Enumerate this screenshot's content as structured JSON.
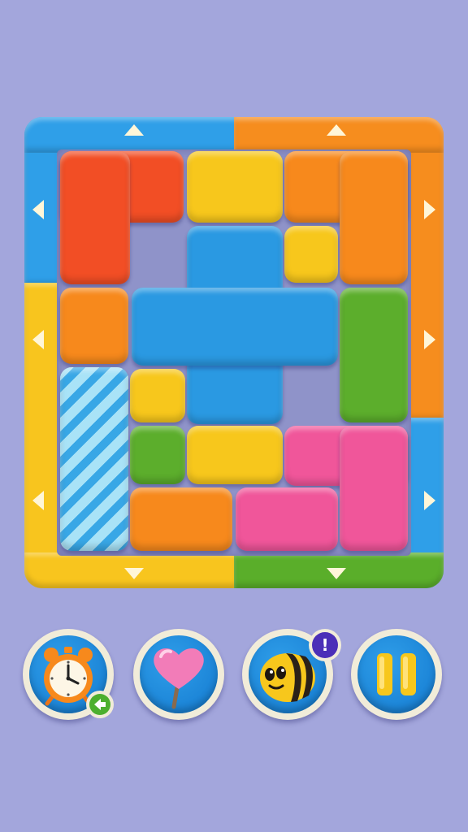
{
  "game": {
    "board": {
      "columns": 5,
      "rows": 6,
      "exit_arrows": [
        "up",
        "up",
        "left",
        "right",
        "left",
        "right",
        "left",
        "right",
        "down",
        "down"
      ],
      "frame_colors": {
        "top_left": "#2f9fe8",
        "top_right": "#f68d1e",
        "left_top": "#2f9fe8",
        "left_bottom": "#f8c51e",
        "right_top": "#f68d1e",
        "right_bottom": "#2f9fe8",
        "bottom_left": "#f8c51e",
        "bottom_right": "#5aae2a"
      },
      "block_colors": {
        "red": "#f24e25",
        "yellow": "#f7c71c",
        "orange": "#f7891c",
        "blue": "#2a99e2",
        "green": "#5cae2c",
        "pink": "#f0569a",
        "striped_light_blue": "#a9e3f7"
      },
      "blocks": [
        {
          "name": "red-l-block",
          "color": "red"
        },
        {
          "name": "yellow-block-top",
          "color": "yellow"
        },
        {
          "name": "orange-l-block-top-right",
          "color": "orange"
        },
        {
          "name": "yellow-small-block-right",
          "color": "yellow"
        },
        {
          "name": "orange-block-left",
          "color": "orange"
        },
        {
          "name": "blue-cross-block",
          "color": "blue"
        },
        {
          "name": "green-tall-block",
          "color": "green"
        },
        {
          "name": "striped-block",
          "color": "striped_light_blue"
        },
        {
          "name": "yellow-small-block-left",
          "color": "yellow"
        },
        {
          "name": "green-small-block",
          "color": "green"
        },
        {
          "name": "yellow-block-middle",
          "color": "yellow"
        },
        {
          "name": "pink-l-block",
          "color": "pink"
        },
        {
          "name": "orange-block-bottom",
          "color": "orange"
        },
        {
          "name": "pink-block-bottom",
          "color": "pink"
        }
      ]
    },
    "buttons": [
      {
        "name": "time-booster-button",
        "icon": "alarm-clock-icon",
        "badge_icon": "rewind-arrow-icon"
      },
      {
        "name": "lollipop-booster-button",
        "icon": "heart-lollipop-icon"
      },
      {
        "name": "bee-booster-button",
        "icon": "bee-icon",
        "badge_text": "!"
      },
      {
        "name": "pause-button",
        "icon": "pause-icon"
      }
    ]
  }
}
